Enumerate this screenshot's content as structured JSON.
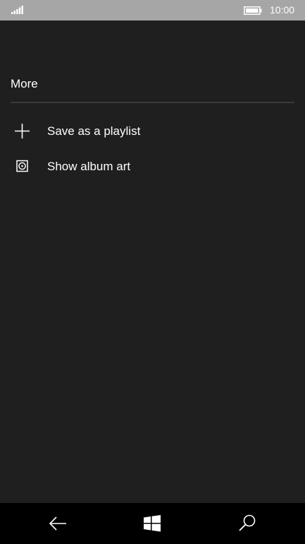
{
  "status_bar": {
    "signal_icon": "signal-strength-icon",
    "battery_icon": "battery-icon",
    "time": "10:00"
  },
  "section": {
    "title": "More"
  },
  "menu": {
    "items": [
      {
        "label": "Save as a playlist",
        "icon": "plus-icon"
      },
      {
        "label": "Show album art",
        "icon": "album-art-icon"
      }
    ]
  },
  "nav_bar": {
    "back_icon": "back-arrow-icon",
    "start_icon": "windows-logo-icon",
    "search_icon": "search-icon"
  },
  "colors": {
    "background": "#1f1f1f",
    "status_bar": "#a6a6a6",
    "nav_bar": "#000000",
    "text": "#ffffff",
    "divider": "#3a3a3a"
  }
}
